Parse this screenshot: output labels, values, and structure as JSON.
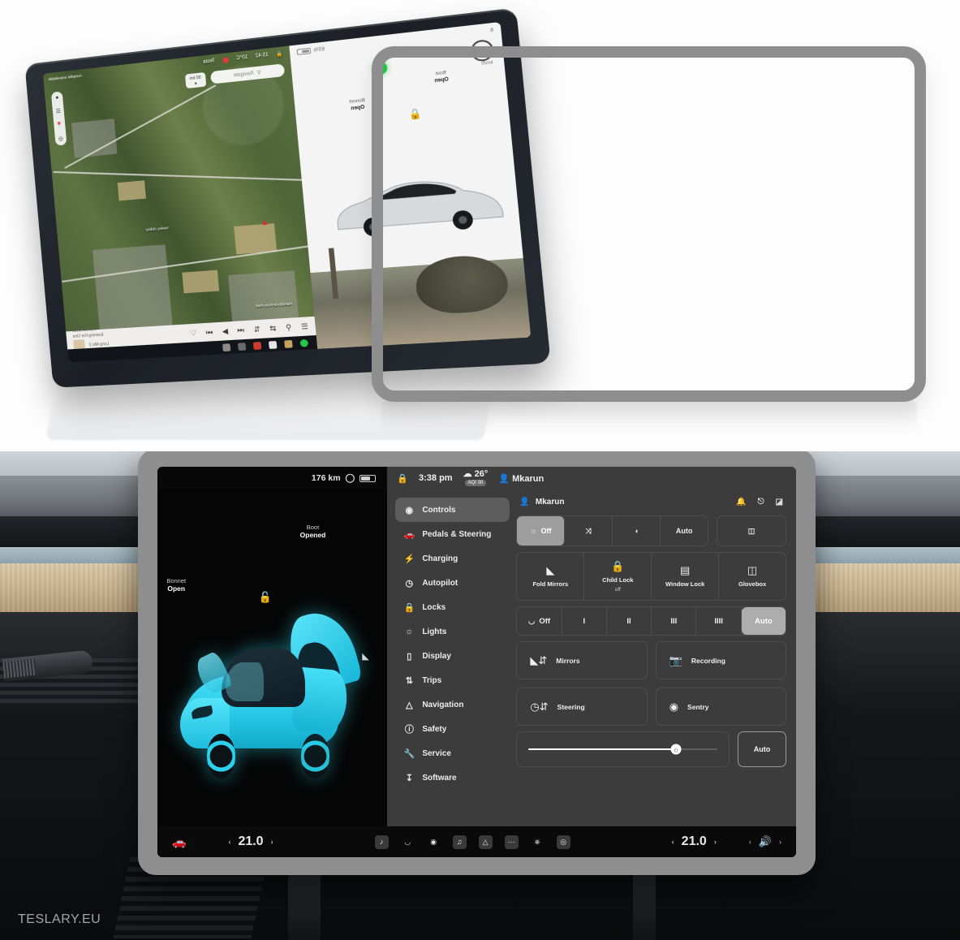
{
  "product": {
    "watermark": "TESLARY.EU"
  },
  "top_scene": {
    "tablet_display": {
      "left_pane": {
        "odometer_unit": "km/h",
        "range_label": "6",
        "battery_percent": "65%",
        "boot_label_top": "Boot",
        "boot_label_bottom": "Open",
        "bonnet_label_top": "Bonnet",
        "bonnet_label_bottom": "Open",
        "lock_icon": "unlock-icon",
        "status_dot": "green-dot"
      },
      "map_pane": {
        "status_time": "15:42",
        "status_temp": "10°C",
        "status_user": "Tesla",
        "rec_indicator": "recording-dot",
        "search_placeholder": "Navigate",
        "nav_button": "90 km",
        "place_labels": [
          "Hamble-le-Rice Park",
          "Netley Abbey"
        ],
        "rail_icons": [
          "satellite-icon",
          "list-icon",
          "pin-icon",
          "target-icon"
        ],
        "top_right_label": "Autopilot unavailable"
      },
      "media": {
        "track_title": "The AM Desk",
        "track_artist": "Evening For One",
        "track_album": "Long Mix 2",
        "controls": [
          "queue-icon",
          "search-icon",
          "shuffle-icon",
          "repeat-icon",
          "previous-icon",
          "play-icon",
          "next-icon",
          "heart-icon"
        ]
      },
      "dock_apps": [
        "phone-app",
        "gallery-app",
        "notes-app",
        "camera-app",
        "calculator-app",
        "media-app"
      ]
    },
    "screen_protector": {
      "label": "screen-protector-frame",
      "frame_color": "#8e8e8e"
    }
  },
  "main_screen": {
    "status_bar": {
      "range": "176 km",
      "battery_icon": "battery-icon",
      "lock_icon": "lock-icon",
      "time": "3:38 pm",
      "weather_icon": "cloud-icon",
      "temperature": "26°",
      "aqi": "AQI 30",
      "profile_icon": "person-icon",
      "profile_name": "Mkarun"
    },
    "car_visual": {
      "boot_label_top": "Boot",
      "boot_label_bottom": "Opened",
      "bonnet_label_top": "Bonnet",
      "bonnet_label_bottom": "Open",
      "lock_icon": "unlocked-icon",
      "mirror_icon": "mirror-icon",
      "car_color": "#2bd0ea"
    },
    "sidebar": {
      "items": [
        {
          "label": "Controls",
          "icon": "car-controls-icon",
          "active": true
        },
        {
          "label": "Pedals & Steering",
          "icon": "car-icon",
          "active": false
        },
        {
          "label": "Charging",
          "icon": "bolt-icon",
          "active": false
        },
        {
          "label": "Autopilot",
          "icon": "steering-wheel-icon",
          "active": false
        },
        {
          "label": "Locks",
          "icon": "lock-icon",
          "active": false
        },
        {
          "label": "Lights",
          "icon": "sun-icon",
          "active": false
        },
        {
          "label": "Display",
          "icon": "display-icon",
          "active": false
        },
        {
          "label": "Trips",
          "icon": "trips-icon",
          "active": false
        },
        {
          "label": "Navigation",
          "icon": "navigation-arrow-icon",
          "active": false
        },
        {
          "label": "Safety",
          "icon": "alert-icon",
          "active": false
        },
        {
          "label": "Service",
          "icon": "wrench-icon",
          "active": false
        },
        {
          "label": "Software",
          "icon": "download-icon",
          "active": false
        }
      ]
    },
    "panel": {
      "header": {
        "profile_icon": "person-icon",
        "profile_name": "Mkarun",
        "bell_icon": "bell-icon",
        "bluetooth_icon": "bluetooth-icon",
        "wifi_icon": "wifi-icon"
      },
      "lights_row": {
        "cells": [
          {
            "label": "Off",
            "icon": "sun-icon",
            "selected": true
          },
          {
            "label": "",
            "icon": "parking-lights-icon",
            "selected": false
          },
          {
            "label": "",
            "icon": "low-beam-icon",
            "selected": false
          },
          {
            "label": "Auto",
            "icon": "",
            "selected": false
          }
        ],
        "high_beam": {
          "label": "",
          "icon": "high-beam-icon",
          "selected": false
        }
      },
      "tiles": [
        {
          "label": "Fold Mirrors",
          "sub": "",
          "icon": "mirror-icon"
        },
        {
          "label": "Child Lock",
          "sub": "off",
          "icon": "child-lock-icon"
        },
        {
          "label": "Window Lock",
          "sub": "",
          "icon": "window-lock-icon"
        },
        {
          "label": "Glovebox",
          "sub": "",
          "icon": "glovebox-icon"
        }
      ],
      "wipers": [
        {
          "label": "Off",
          "icon": "wiper-icon",
          "selected": false
        },
        {
          "label": "I",
          "icon": "",
          "selected": false
        },
        {
          "label": "II",
          "icon": "",
          "selected": false
        },
        {
          "label": "III",
          "icon": "",
          "selected": false
        },
        {
          "label": "IIII",
          "icon": "",
          "selected": false
        },
        {
          "label": "Auto",
          "icon": "",
          "selected": true
        }
      ],
      "quad": [
        {
          "label": "Mirrors",
          "icon": "mirror-adjust-icon"
        },
        {
          "label": "Recording",
          "icon": "dashcam-icon"
        },
        {
          "label": "Steering",
          "icon": "steering-adjust-icon"
        },
        {
          "label": "Sentry",
          "icon": "sentry-icon"
        }
      ],
      "brightness": {
        "value_percent": 78,
        "handle_icon": "brightness-icon",
        "auto_label": "Auto"
      }
    },
    "app_bar": {
      "car_icon": "car-icon",
      "temp_left": "21.0",
      "temp_right": "21.0",
      "seat_icon": "seat-dots-icon",
      "apps": [
        "media-icon",
        "wiper-icon",
        "climate-icon",
        "music-icon",
        "chart-icon",
        "more-icon",
        "power-icon",
        "camera-icon"
      ],
      "volume_icon": "volume-icon"
    }
  }
}
